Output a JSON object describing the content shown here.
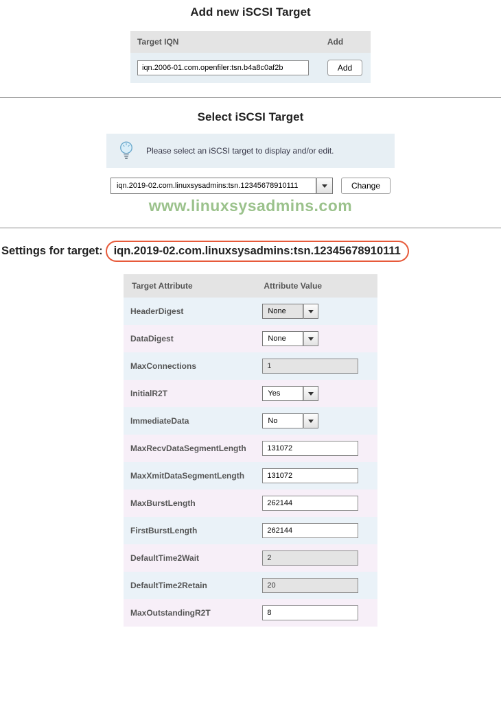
{
  "add_section": {
    "title": "Add new iSCSI Target",
    "col_iqn": "Target IQN",
    "col_add": "Add",
    "iqn_value": "iqn.2006-01.com.openfiler:tsn.b4a8c0af2b",
    "add_label": "Add"
  },
  "select_section": {
    "title": "Select iSCSI Target",
    "info_text": "Please select an iSCSI target to display and/or edit.",
    "selected_target": "iqn.2019-02.com.linuxsysadmins:tsn.12345678910111",
    "change_label": "Change"
  },
  "watermark": "www.linuxsysadmins.com",
  "settings": {
    "label": "Settings for target:",
    "target": "iqn.2019-02.com.linuxsysadmins:tsn.12345678910111",
    "col_attr": "Target Attribute",
    "col_val": "Attribute Value",
    "rows": [
      {
        "name": "HeaderDigest",
        "type": "select",
        "value": "None",
        "readonly": true
      },
      {
        "name": "DataDigest",
        "type": "select",
        "value": "None",
        "readonly": false
      },
      {
        "name": "MaxConnections",
        "type": "text",
        "value": "1",
        "readonly": true
      },
      {
        "name": "InitialR2T",
        "type": "select",
        "value": "Yes",
        "readonly": false
      },
      {
        "name": "ImmediateData",
        "type": "select",
        "value": "No",
        "readonly": false
      },
      {
        "name": "MaxRecvDataSegmentLength",
        "type": "text",
        "value": "131072",
        "readonly": false
      },
      {
        "name": "MaxXmitDataSegmentLength",
        "type": "text",
        "value": "131072",
        "readonly": false
      },
      {
        "name": "MaxBurstLength",
        "type": "text",
        "value": "262144",
        "readonly": false
      },
      {
        "name": "FirstBurstLength",
        "type": "text",
        "value": "262144",
        "readonly": false
      },
      {
        "name": "DefaultTime2Wait",
        "type": "text",
        "value": "2",
        "readonly": true
      },
      {
        "name": "DefaultTime2Retain",
        "type": "text",
        "value": "20",
        "readonly": true
      },
      {
        "name": "MaxOutstandingR2T",
        "type": "text",
        "value": "8",
        "readonly": false
      }
    ]
  }
}
